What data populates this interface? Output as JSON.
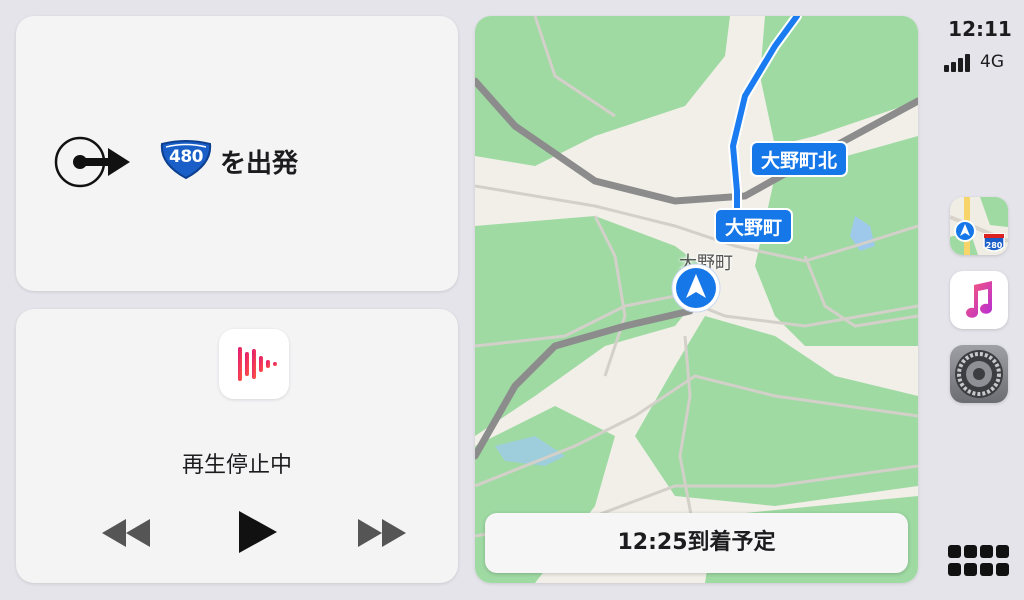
{
  "navigation": {
    "route_shield": "480",
    "maneuver": "を出発"
  },
  "now_playing": {
    "status": "再生停止中"
  },
  "map": {
    "labels": [
      "大野町北",
      "大野町"
    ],
    "town_name": "大野町",
    "eta": "12:25到着予定"
  },
  "status_bar": {
    "time": "12:11",
    "network": "4G",
    "signal_bars": 4
  },
  "dock": {
    "apps": [
      "maps-icon",
      "music-icon",
      "settings-icon"
    ],
    "maps_shield": "280"
  },
  "colors": {
    "accent": "#1677e8",
    "route": "#1a7cf0",
    "park": "#9dd9a2",
    "expressway": "#8a8a8a"
  }
}
